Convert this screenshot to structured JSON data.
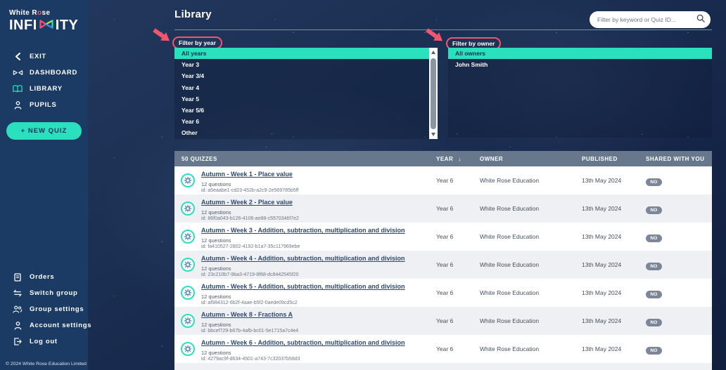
{
  "colors": {
    "accent_teal": "#2be0bd",
    "annotation_pink": "#f2566f",
    "sidebar_navy": "#1b3b65",
    "table_header_slate": "#68788c",
    "link_blue": "#2b4a72",
    "badge_gray": "#7c8698"
  },
  "sidebar": {
    "brand": {
      "pre": "White R",
      "accent": "o",
      "post": "se",
      "word_start": "INFI",
      "word_end": "ITY",
      "mark_icon": "infinity-mark-icon"
    },
    "nav": [
      {
        "label": "EXIT",
        "icon": "chevron-left-icon"
      },
      {
        "label": "DASHBOARD",
        "icon": "infinity-icon"
      },
      {
        "label": "LIBRARY",
        "icon": "book-icon",
        "active": true
      },
      {
        "label": "PUPILS",
        "icon": "pupil-icon"
      }
    ],
    "new_quiz_label": "+  NEW QUIZ",
    "footer_nav": [
      {
        "label": "Orders",
        "icon": "document-icon"
      },
      {
        "label": "Switch group",
        "icon": "switch-arrows-icon"
      },
      {
        "label": "Group settings",
        "icon": "people-icon"
      },
      {
        "label": "Account settings",
        "icon": "person-icon"
      },
      {
        "label": "Log out",
        "icon": "logout-icon"
      }
    ],
    "copyright": "© 2024 White Rose Education Limited"
  },
  "header": {
    "title": "Library",
    "search_placeholder": "Filter by keyword or Quiz ID..."
  },
  "filters": {
    "year": {
      "label": "Filter by year",
      "selected_index": 0,
      "options": [
        "All years",
        "Year 3",
        "Year 3/4",
        "Year 4",
        "Year 5",
        "Year 5/6",
        "Year 6",
        "Other"
      ]
    },
    "owner": {
      "label": "Filter by owner",
      "selected_index": 0,
      "options": [
        "All owners",
        "John Smith"
      ]
    }
  },
  "table": {
    "count_label": "50 QUIZZES",
    "columns": [
      "YEAR",
      "OWNER",
      "PUBLISHED",
      "SHARED WITH YOU"
    ],
    "sort_icon": "↓",
    "rows": [
      {
        "title": "Autumn - Week 1 - Place value",
        "questions": "12 questions",
        "id": "id: a5eaabe1-cd23-452b-a2c9-2e569785b5ff",
        "year": "Year 6",
        "owner": "White Rose Education",
        "published": "13th May 2024",
        "shared": "NO"
      },
      {
        "title": "Autumn - Week 2 - Place value",
        "questions": "12 questions",
        "id": "id: 86f0a043-b126-4106-ae88-c5570346f7e2",
        "year": "Year 6",
        "owner": "White Rose Education",
        "published": "13th May 2024",
        "shared": "NO"
      },
      {
        "title": "Autumn - Week 3 - Addition, subtraction, multiplication and division",
        "questions": "12 questions",
        "id": "id: fa410527-2802-4192-b1a7-35c117969ebe",
        "year": "Year 6",
        "owner": "White Rose Education",
        "published": "13th May 2024",
        "shared": "NO"
      },
      {
        "title": "Autumn - Week 4 - Addition, subtraction, multiplication and division",
        "questions": "12 questions",
        "id": "id: 23c210b7-9ba3-4719-8f68-dc8442545f20",
        "year": "Year 6",
        "owner": "White Rose Education",
        "published": "13th May 2024",
        "shared": "NO"
      },
      {
        "title": "Autumn - Week 5 - Addition, subtraction, multiplication and division",
        "questions": "12 questions",
        "id": "id: af984312-6b2f-4aae-b5f2-0aede09cd5c2",
        "year": "Year 6",
        "owner": "White Rose Education",
        "published": "13th May 2024",
        "shared": "NO"
      },
      {
        "title": "Autumn - Week 8 - Fractions A",
        "questions": "12 questions",
        "id": "id: bbcef729-b67b-4afb-bc01-5e1715a7c4e4",
        "year": "Year 6",
        "owner": "White Rose Education",
        "published": "13th May 2024",
        "shared": "NO"
      },
      {
        "title": "Autumn - Week 6 - Addition, subtraction, multiplication and division",
        "questions": "12 questions",
        "id": "id: 4279ac9f-d634-4501-a743-7c32037b58d3",
        "year": "Year 6",
        "owner": "White Rose Education",
        "published": "13th May 2024",
        "shared": "NO"
      }
    ]
  }
}
